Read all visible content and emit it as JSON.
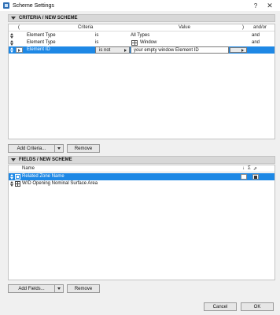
{
  "window": {
    "title": "Scheme Settings",
    "help": "?",
    "close": "✕"
  },
  "criteria": {
    "header": "CRITERIA / NEW SCHEME",
    "columns": {
      "open_paren": "(",
      "criteria": "Criteria",
      "value": "Value",
      "close_paren": ")",
      "andor": "and/or"
    },
    "rows": [
      {
        "criteria": "Element Type",
        "operator": "is",
        "value": "All Types",
        "andor": "and"
      },
      {
        "criteria": "Element Type",
        "operator": "is",
        "value": "Window",
        "andor": "and"
      },
      {
        "criteria": "Element ID",
        "operator": "is not",
        "value": "your empty window Element ID",
        "andor": ""
      }
    ],
    "add_button": "Add Criteria...",
    "remove_button": "Remove"
  },
  "fields": {
    "header": "FIELDS / NEW SCHEME",
    "columns": {
      "name": "Name",
      "sort": "↓",
      "sum": "Σ",
      "unit": "⇗"
    },
    "rows": [
      {
        "name": "Related Zone Name"
      },
      {
        "name": "W/D Opening Nominal Surface Area"
      }
    ],
    "add_button": "Add Fields...",
    "remove_button": "Remove"
  },
  "footer": {
    "cancel": "Cancel",
    "ok": "OK"
  },
  "icons": {
    "window_value_icon": "window-element-icon",
    "zone_icon": "zone-icon",
    "wd_icon": "window-door-icon"
  },
  "colors": {
    "selection": "#1e88e5"
  }
}
